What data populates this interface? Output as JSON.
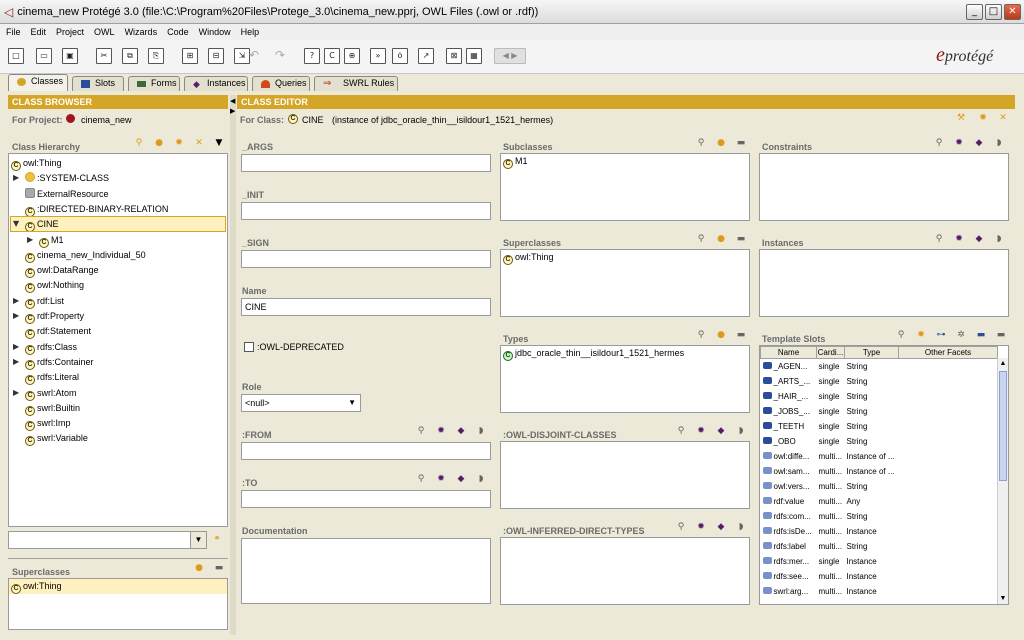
{
  "window": {
    "title": "cinema_new  Protégé 3.0     (file:\\C:\\Program%20Files\\Protege_3.0\\cinema_new.pprj, OWL Files (.owl or .rdf))",
    "minimize": "_",
    "maximize": "□",
    "close": "✕"
  },
  "menu": [
    "File",
    "Edit",
    "Project",
    "OWL",
    "Wizards",
    "Code",
    "Window",
    "Help"
  ],
  "logo": {
    "mark": "e",
    "text": "protégé"
  },
  "tabs": [
    "Classes",
    "Slots",
    "Forms",
    "Instances",
    "Queries",
    "SWRL Rules"
  ],
  "class_browser": {
    "header": "CLASS BROWSER",
    "for_project_label": "For Project:",
    "project": "cinema_new",
    "hierarchy_label": "Class Hierarchy",
    "tree": [
      {
        "label": "owl:Thing",
        "indent": 0,
        "expand": "",
        "icon": "c"
      },
      {
        "label": ":SYSTEM-CLASS",
        "indent": 1,
        "expand": "▶",
        "icon": "sys"
      },
      {
        "label": "ExternalResource",
        "indent": 1,
        "expand": "",
        "icon": "ext"
      },
      {
        "label": ":DIRECTED-BINARY-RELATION",
        "indent": 1,
        "expand": "",
        "icon": "c"
      },
      {
        "label": "CINE",
        "indent": 1,
        "expand": "▼",
        "icon": "c",
        "selected": true
      },
      {
        "label": "M1",
        "indent": 2,
        "expand": "▶",
        "icon": "c"
      },
      {
        "label": "cinema_new_Individual_50",
        "indent": 1,
        "expand": "",
        "icon": "c"
      },
      {
        "label": "owl:DataRange",
        "indent": 1,
        "expand": "",
        "icon": "c"
      },
      {
        "label": "owl:Nothing",
        "indent": 1,
        "expand": "",
        "icon": "c"
      },
      {
        "label": "rdf:List",
        "indent": 1,
        "expand": "▶",
        "icon": "c"
      },
      {
        "label": "rdf:Property",
        "indent": 1,
        "expand": "▶",
        "icon": "c"
      },
      {
        "label": "rdf:Statement",
        "indent": 1,
        "expand": "",
        "icon": "c"
      },
      {
        "label": "rdfs:Class",
        "indent": 1,
        "expand": "▶",
        "icon": "c"
      },
      {
        "label": "rdfs:Container",
        "indent": 1,
        "expand": "▶",
        "icon": "c"
      },
      {
        "label": "rdfs:Literal",
        "indent": 1,
        "expand": "",
        "icon": "c"
      },
      {
        "label": "swrl:Atom",
        "indent": 1,
        "expand": "▶",
        "icon": "c"
      },
      {
        "label": "swrl:Builtin",
        "indent": 1,
        "expand": "",
        "icon": "c"
      },
      {
        "label": "swrl:Imp",
        "indent": 1,
        "expand": "",
        "icon": "c"
      },
      {
        "label": "swrl:Variable",
        "indent": 1,
        "expand": "",
        "icon": "c"
      }
    ],
    "superclasses_label": "Superclasses",
    "superclasses": [
      "owl:Thing"
    ]
  },
  "class_editor": {
    "header": "CLASS EDITOR",
    "for_class_label": "For Class:",
    "class_name": "CINE",
    "instance_of": "(instance of jdbc_oracle_thin__isildour1_1521_hermes)",
    "args_label": "_ARGS",
    "init_label": "_INIT",
    "sign_label": "_SIGN",
    "name_label": "Name",
    "name_value": "CINE",
    "deprecated_label": ":OWL-DEPRECATED",
    "role_label": "Role",
    "role_value": "<null>",
    "from_label": ":FROM",
    "to_label": ":TO",
    "documentation_label": "Documentation",
    "subclasses_label": "Subclasses",
    "subclasses": [
      "M1"
    ],
    "superclasses_label": "Superclasses",
    "superclasses": [
      "owl:Thing"
    ],
    "types_label": "Types",
    "types": [
      "jdbc_oracle_thin__isildour1_1521_hermes"
    ],
    "disjoint_label": ":OWL-DISJOINT-CLASSES",
    "inferred_label": ":OWL-INFERRED-DIRECT-TYPES",
    "constraints_label": "Constraints",
    "instances_label": "Instances",
    "template_slots_label": "Template Slots",
    "slot_columns": [
      "Name",
      "Cardi...",
      "Type",
      "Other Facets"
    ],
    "slots": [
      {
        "name": "_AGEN...",
        "card": "single",
        "type": "String",
        "dark": true
      },
      {
        "name": "_ARTS_...",
        "card": "single",
        "type": "String",
        "dark": true
      },
      {
        "name": "_HAIR_...",
        "card": "single",
        "type": "String",
        "dark": true
      },
      {
        "name": "_JOBS_...",
        "card": "single",
        "type": "String",
        "dark": true
      },
      {
        "name": "_TEETH",
        "card": "single",
        "type": "String",
        "dark": true
      },
      {
        "name": "_OBO",
        "card": "single",
        "type": "String",
        "dark": true
      },
      {
        "name": "owl:diffe...",
        "card": "multi...",
        "type": "Instance of ...",
        "dark": false
      },
      {
        "name": "owl:sam...",
        "card": "multi...",
        "type": "Instance of ...",
        "dark": false
      },
      {
        "name": "owl:vers...",
        "card": "multi...",
        "type": "String",
        "dark": false
      },
      {
        "name": "rdf:value",
        "card": "multi...",
        "type": "Any",
        "dark": false
      },
      {
        "name": "rdfs:com...",
        "card": "multi...",
        "type": "String",
        "dark": false
      },
      {
        "name": "rdfs:isDe...",
        "card": "multi...",
        "type": "Instance",
        "dark": false
      },
      {
        "name": "rdfs:label",
        "card": "multi...",
        "type": "String",
        "dark": false
      },
      {
        "name": "rdfs:mer...",
        "card": "single",
        "type": "Instance",
        "dark": false
      },
      {
        "name": "rdfs:see...",
        "card": "multi...",
        "type": "Instance",
        "dark": false
      },
      {
        "name": "swrl:arg...",
        "card": "multi...",
        "type": "Instance",
        "dark": false
      }
    ]
  }
}
